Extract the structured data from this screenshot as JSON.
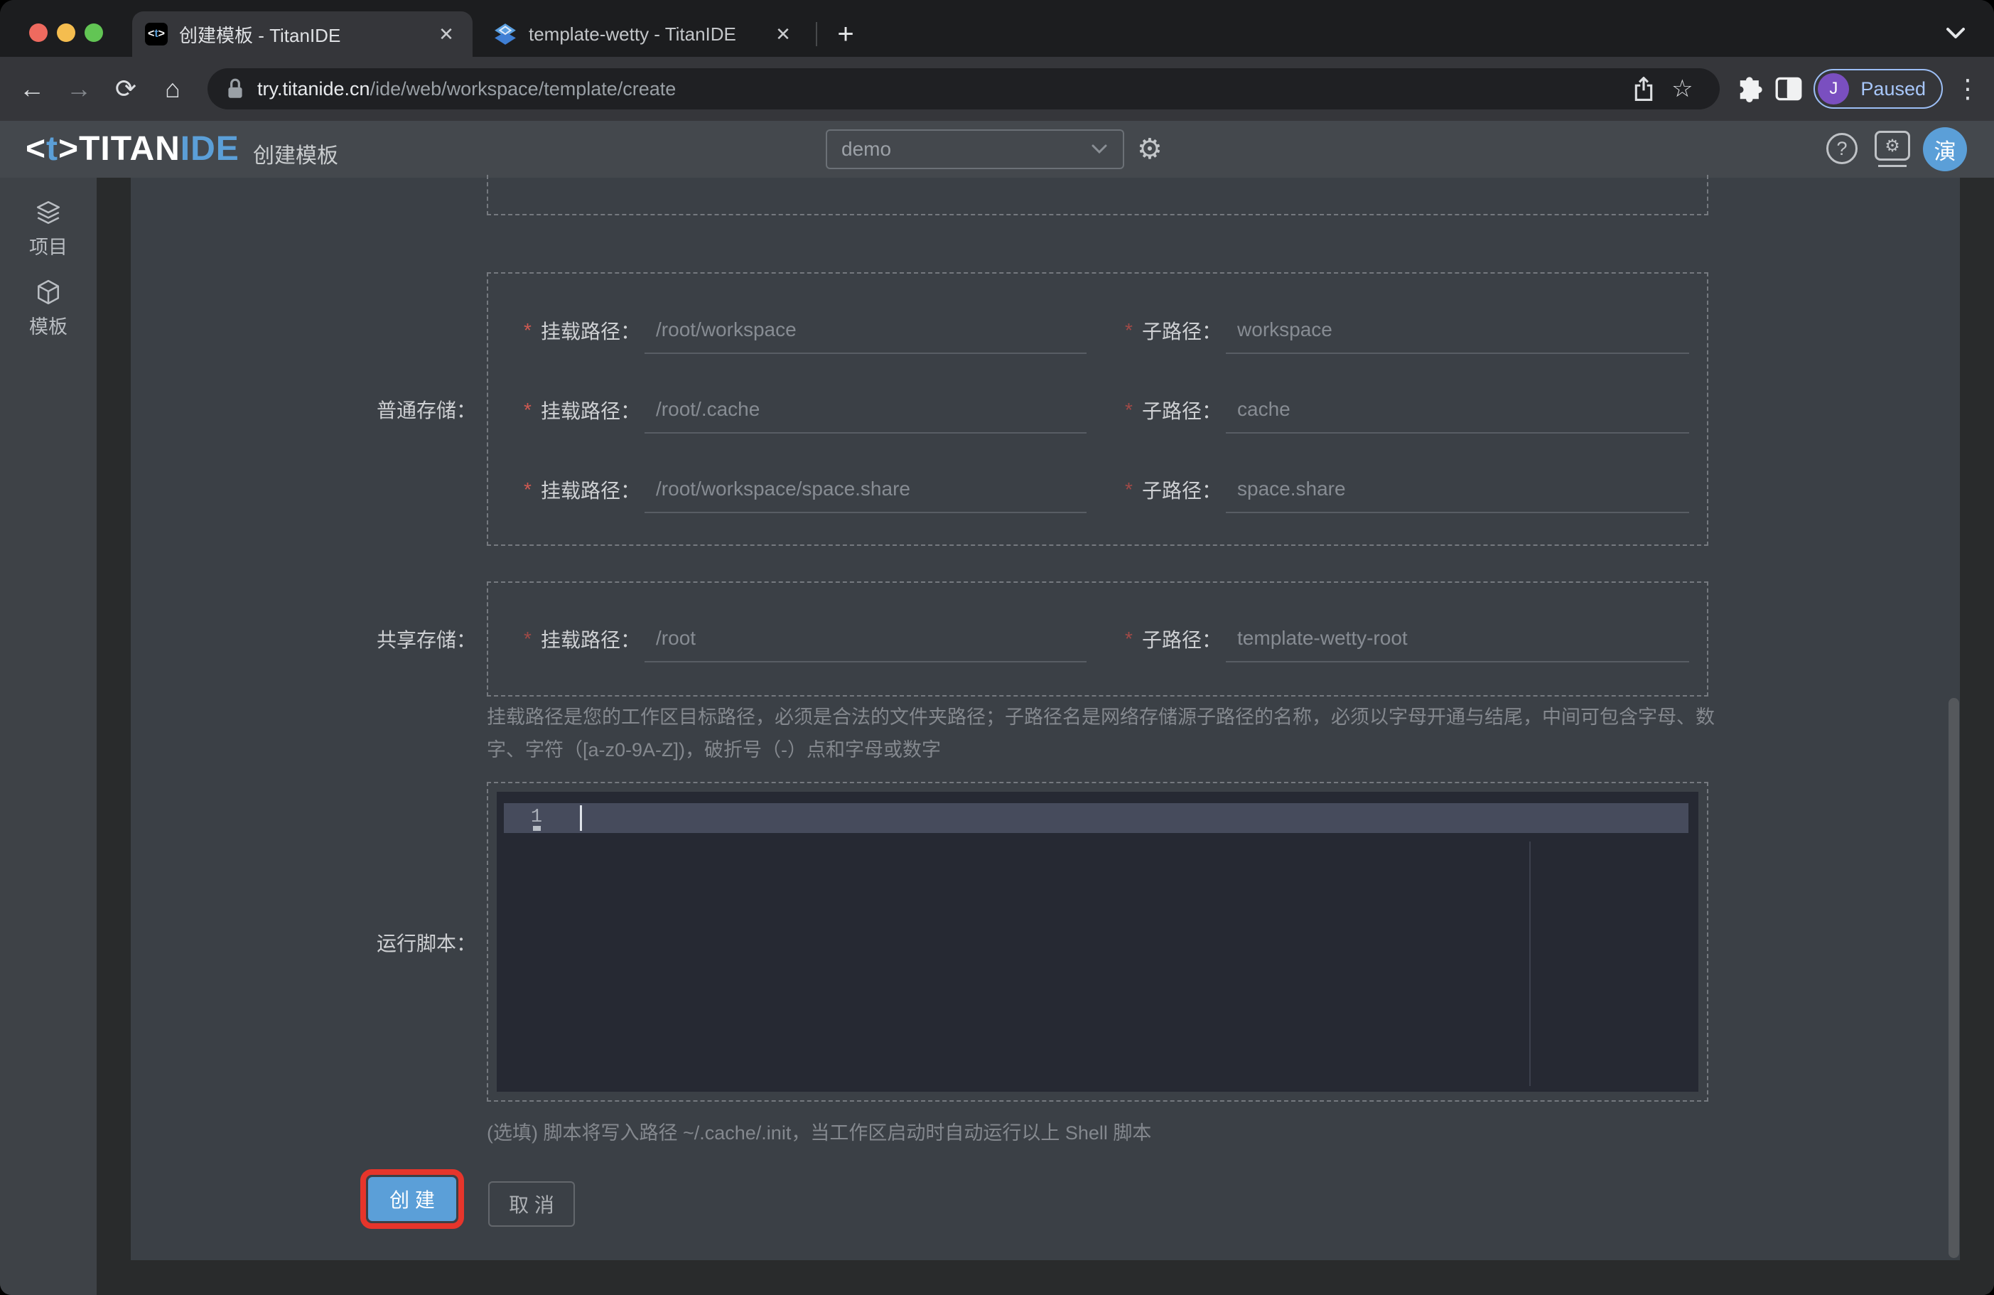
{
  "colors": {
    "accent_blue": "#5b9fd8",
    "create_button_blue": "#5b9fd8",
    "highlight_red": "#e6352b",
    "paused_badge_blue": "#a8c7fa",
    "profile_avatar_purple": "#7a4fc0",
    "editor_background": "#262933"
  },
  "browser": {
    "tabs": [
      {
        "title": "创建模板 - TitanIDE"
      },
      {
        "title": "template-wetty - TitanIDE"
      }
    ],
    "url": {
      "domain": "try.titanide.cn",
      "path": "/ide/web/workspace/template/create"
    },
    "profile": {
      "initial": "J",
      "label": "Paused"
    },
    "glyphs": {
      "close": "✕",
      "new_tab": "+",
      "back": "←",
      "forward": "→",
      "reload": "⟳",
      "home": "⌂",
      "star": "☆",
      "menu": "⋮"
    }
  },
  "header": {
    "logo": {
      "l1": "<",
      "l2": "t",
      "l3": ">",
      "l4": "TITAN",
      "l5": "IDE"
    },
    "page_title": "创建模板",
    "workspace_select": {
      "value": "demo"
    },
    "gear": "⚙",
    "help": "?",
    "monitor_gear": "⚙",
    "avatar": "演"
  },
  "sidebar": {
    "items": [
      {
        "label": "项目"
      },
      {
        "label": "模板"
      }
    ]
  },
  "form": {
    "required_mark": "*",
    "normal_storage": {
      "label": "普通存储：",
      "rows": [
        {
          "mount_label": "挂载路径：",
          "mount_value": "/root/workspace",
          "sub_label": "子路径：",
          "sub_value": "workspace"
        },
        {
          "mount_label": "挂载路径：",
          "mount_value": "/root/.cache",
          "sub_label": "子路径：",
          "sub_value": "cache"
        },
        {
          "mount_label": "挂载路径：",
          "mount_value": "/root/workspace/space.share",
          "sub_label": "子路径：",
          "sub_value": "space.share"
        }
      ]
    },
    "shared_storage": {
      "label": "共享存储：",
      "rows": [
        {
          "mount_label": "挂载路径：",
          "mount_value": "/root",
          "sub_label": "子路径：",
          "sub_value": "template-wetty-root"
        }
      ]
    },
    "path_hint": "挂载路径是您的工作区目标路径，必须是合法的文件夹路径；子路径名是网络存储源子路径的名称，必须以字母开通与结尾，中间可包含字母、数字、字符（[a-z0-9A-Z])，破折号（-）点和字母或数字",
    "run_script": {
      "label": "运行脚本：",
      "line_number": "1",
      "note": "(选填) 脚本将写入路径 ~/.cache/.init，当工作区启动时自动运行以上 Shell 脚本"
    },
    "actions": {
      "create": "创 建",
      "cancel": "取 消"
    }
  }
}
